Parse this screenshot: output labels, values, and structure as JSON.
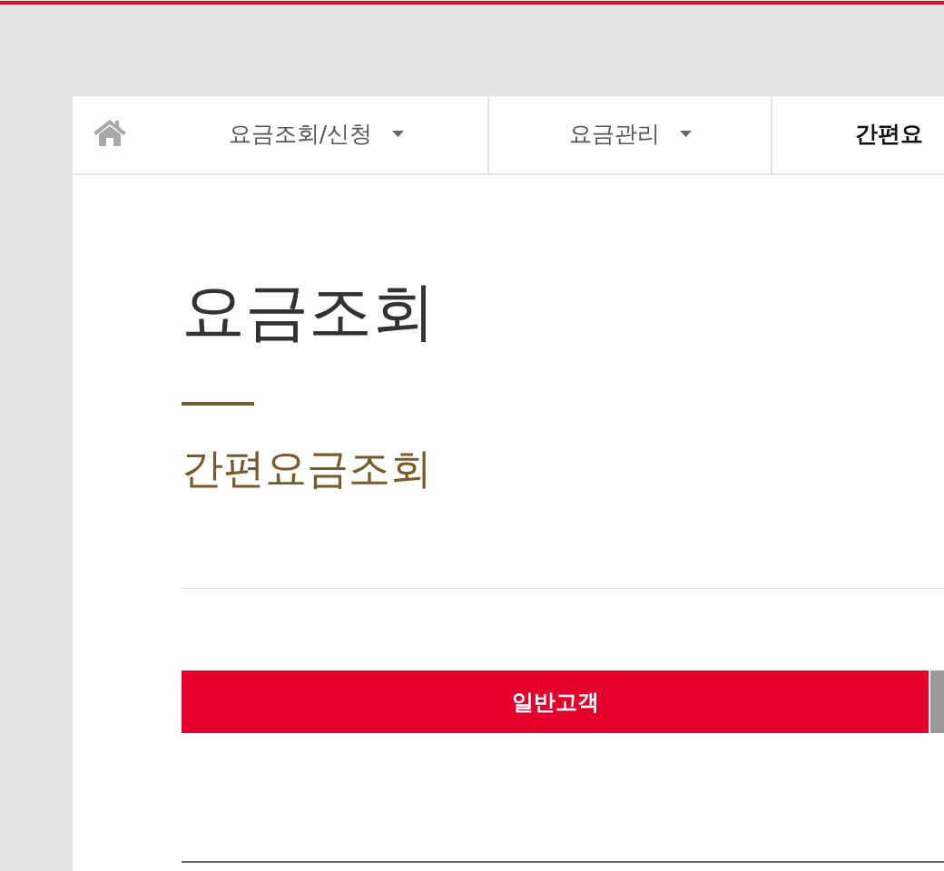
{
  "nav": {
    "items": [
      {
        "label": "요금조회/신청",
        "dropdown": true,
        "selected": false
      },
      {
        "label": "요금관리",
        "dropdown": true,
        "selected": false
      },
      {
        "label": "간편요",
        "dropdown": false,
        "selected": true
      }
    ]
  },
  "page": {
    "title": "요금조회",
    "subtitle": "간편요금조회"
  },
  "customer_tabs": [
    {
      "label": "일반고객",
      "selected": true
    },
    {
      "selected": false
    }
  ]
}
